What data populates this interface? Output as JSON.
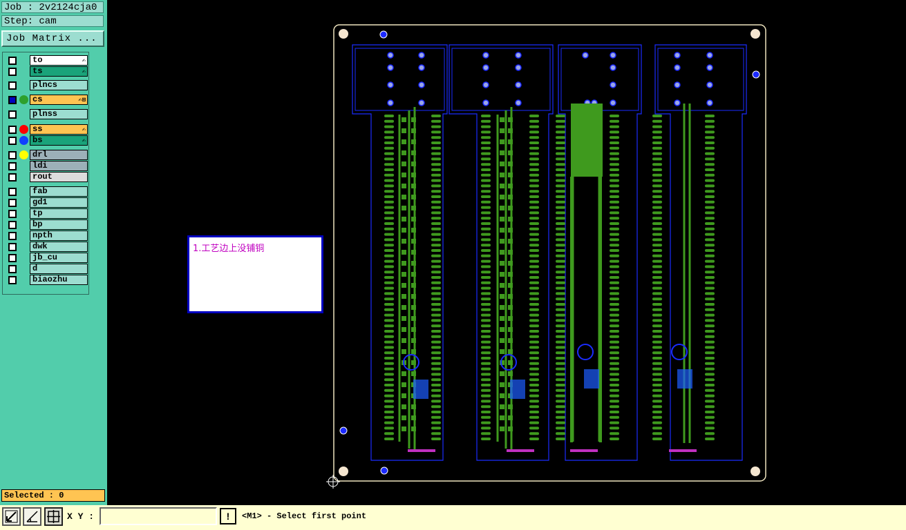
{
  "header": {
    "job": "Job : 2v2124cja0",
    "step": "Step: cam",
    "job_matrix_label": "Job Matrix ..."
  },
  "layers": [
    {
      "name": "to",
      "color": "#ffffff",
      "dot": "",
      "checked": false,
      "flags": "✍"
    },
    {
      "name": "ts",
      "color": "#1aa37a",
      "dot": "",
      "checked": false,
      "flags": "✍"
    },
    {
      "name": "plncs",
      "color": "#9cddd0",
      "dot": "",
      "checked": false,
      "flags": ""
    },
    {
      "name": "cs",
      "color": "#ffc452",
      "dot": "#2da02d",
      "checked": true,
      "flags": "✍⊞"
    },
    {
      "name": "plnss",
      "color": "#9cddd0",
      "dot": "",
      "checked": false,
      "flags": ""
    },
    {
      "name": "ss",
      "color": "#ffc452",
      "dot": "#ff0000",
      "checked": false,
      "flags": "✍"
    },
    {
      "name": "bs",
      "color": "#1aa37a",
      "dot": "#1040ff",
      "checked": false,
      "flags": "✍"
    },
    {
      "name": "drl",
      "color": "#9cb0b8",
      "dot": "#ffff00",
      "checked": false,
      "flags": ""
    },
    {
      "name": "ldi",
      "color": "#9cb0b8",
      "dot": "",
      "checked": false,
      "flags": ""
    },
    {
      "name": "rout",
      "color": "#dcdcdc",
      "dot": "",
      "checked": false,
      "flags": ""
    },
    {
      "name": "fab",
      "color": "#9cddd0",
      "dot": "",
      "checked": false,
      "flags": ""
    },
    {
      "name": "gd1",
      "color": "#9cddd0",
      "dot": "",
      "checked": false,
      "flags": ""
    },
    {
      "name": "tp",
      "color": "#9cddd0",
      "dot": "",
      "checked": false,
      "flags": ""
    },
    {
      "name": "bp",
      "color": "#9cddd0",
      "dot": "",
      "checked": false,
      "flags": ""
    },
    {
      "name": "npth",
      "color": "#9cddd0",
      "dot": "",
      "checked": false,
      "flags": ""
    },
    {
      "name": "dwk",
      "color": "#9cddd0",
      "dot": "",
      "checked": false,
      "flags": ""
    },
    {
      "name": "jb_cu",
      "color": "#9cddd0",
      "dot": "",
      "checked": false,
      "flags": ""
    },
    {
      "name": "d",
      "color": "#9cddd0",
      "dot": "",
      "checked": false,
      "flags": ""
    },
    {
      "name": "biaozhu",
      "color": "#9cddd0",
      "dot": "",
      "checked": false,
      "flags": ""
    }
  ],
  "selected": "Selected : 0",
  "statusbar": {
    "xy_label": "X Y :",
    "xy_value": "",
    "alert_label": "!",
    "message": "<M1> - Select first point"
  },
  "note": {
    "text": "1.工艺边上没铺铜"
  },
  "colors": {
    "panel": "#52cdab",
    "statusbar": "#ffffd2",
    "copper": "#3f9a1e",
    "outline": "#1a2cff",
    "border": "#f0e6c0",
    "pad": "#9aa6e6",
    "hole": "#1c2aff"
  }
}
